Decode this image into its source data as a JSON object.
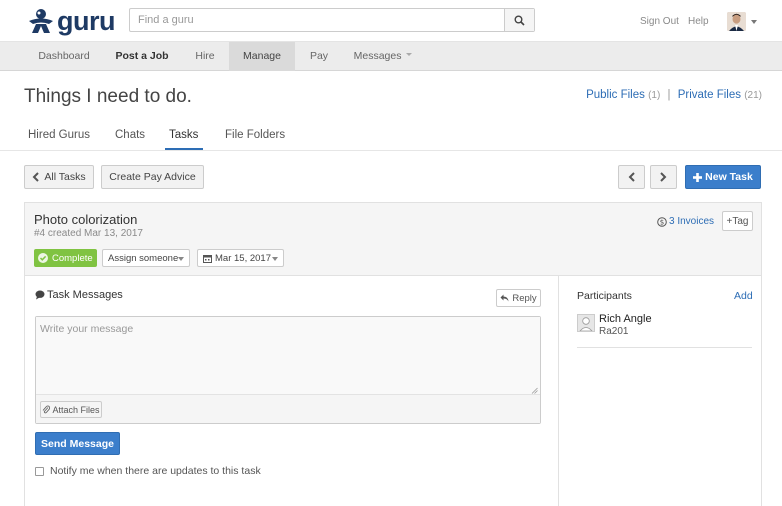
{
  "header": {
    "logo_text": "guru",
    "search_placeholder": "Find a guru",
    "sign_out": "Sign Out",
    "help": "Help"
  },
  "nav": {
    "items": [
      {
        "label": "Dashboard"
      },
      {
        "label": "Post a Job"
      },
      {
        "label": "Hire"
      },
      {
        "label": "Manage"
      },
      {
        "label": "Pay"
      },
      {
        "label": "Messages"
      }
    ]
  },
  "page": {
    "title": "Things I need to do.",
    "public_files_label": "Public Files",
    "public_files_count": "(1)",
    "separator": "|",
    "private_files_label": "Private Files",
    "private_files_count": "(21)"
  },
  "subtabs": [
    {
      "label": "Hired Gurus"
    },
    {
      "label": "Chats"
    },
    {
      "label": "Tasks"
    },
    {
      "label": "File Folders"
    }
  ],
  "toolbar": {
    "all_tasks": "All Tasks",
    "create_pay_advice": "Create Pay Advice",
    "new_task": "New Task"
  },
  "task": {
    "title": "Photo colorization",
    "meta": "#4 created Mar 13, 2017",
    "status": "Complete",
    "assign": "Assign someone",
    "due_date": "Mar 15, 2017",
    "invoices": "3 Invoices",
    "tag": "+Tag"
  },
  "messages": {
    "title": "Task Messages",
    "reply": "Reply",
    "placeholder": "Write your message",
    "attach": "Attach Files",
    "send": "Send Message",
    "notify": "Notify me when there are updates to this task"
  },
  "participants": {
    "title": "Participants",
    "add": "Add",
    "list": [
      {
        "name": "Rich Angle",
        "username": "Ra201"
      }
    ]
  },
  "colors": {
    "brand": "#1e3a64",
    "link": "#2d6db5",
    "primary_button": "#3b7ecb",
    "complete_badge": "#80c342"
  }
}
